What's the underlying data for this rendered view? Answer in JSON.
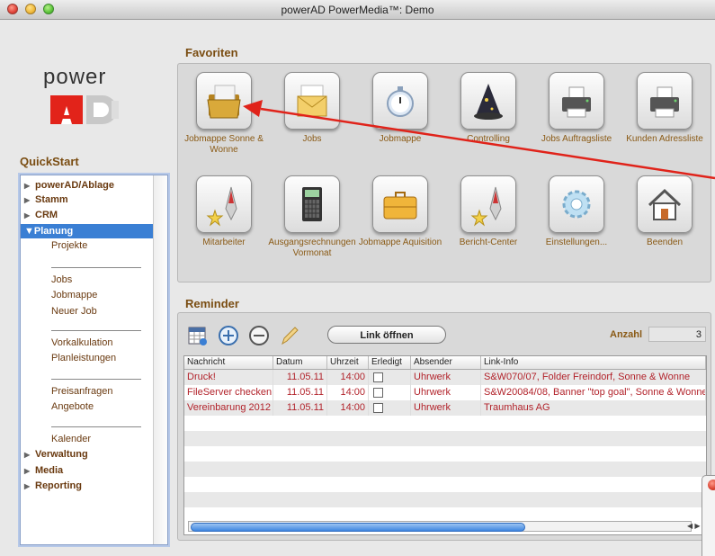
{
  "window": {
    "title": "powerAD PowerMedia™: Demo"
  },
  "logo": {
    "word": "power",
    "letters": "AD"
  },
  "quickstart": {
    "title": "QuickStart",
    "items": [
      {
        "label": "powerAD/Ablage"
      },
      {
        "label": "Stamm"
      },
      {
        "label": "CRM"
      },
      {
        "label": "Planung"
      },
      {
        "label": "Projekte"
      },
      {
        "label": "Jobs"
      },
      {
        "label": "Jobmappe"
      },
      {
        "label": "Neuer Job"
      },
      {
        "label": "Vorkalkulation"
      },
      {
        "label": "Planleistungen"
      },
      {
        "label": "Preisanfragen"
      },
      {
        "label": "Angebote"
      },
      {
        "label": "Kalender"
      },
      {
        "label": "Verwaltung"
      },
      {
        "label": "Media"
      },
      {
        "label": "Reporting"
      }
    ]
  },
  "favorites": {
    "title": "Favoriten",
    "tiles": [
      {
        "label": "Jobmappe Sonne & Wonne",
        "icon": "folder-icon"
      },
      {
        "label": "Jobs",
        "icon": "envelope-icon"
      },
      {
        "label": "Jobmappe",
        "icon": "stopwatch-icon"
      },
      {
        "label": "Controlling",
        "icon": "wizard-hat-icon"
      },
      {
        "label": "Jobs Auftragsliste",
        "icon": "printer-icon"
      },
      {
        "label": "Kunden Adressliste",
        "icon": "printer-icon"
      },
      {
        "label": "Mitarbeiter",
        "icon": "rocket-icon"
      },
      {
        "label": "Ausgangsrechnungen Vormonat",
        "icon": "calculator-icon"
      },
      {
        "label": "Jobmappe Aquisition",
        "icon": "briefcase-icon"
      },
      {
        "label": "Bericht-Center",
        "icon": "rocket-icon"
      },
      {
        "label": "Einstellungen...",
        "icon": "gear-icon"
      },
      {
        "label": "Beenden",
        "icon": "house-icon"
      }
    ]
  },
  "reminder": {
    "title": "Reminder",
    "link_button": "Link öffnen",
    "anzahl_label": "Anzahl",
    "anzahl_value": "3",
    "columns": [
      "Nachricht",
      "Datum",
      "Uhrzeit",
      "Erledigt",
      "Absender",
      "Link-Info"
    ],
    "rows": [
      {
        "nachricht": "Druck!",
        "datum": "11.05.11",
        "uhrzeit": "14:00",
        "erledigt": false,
        "absender": "Uhrwerk",
        "link": "S&W070/07, Folder Freindorf, Sonne & Wonne"
      },
      {
        "nachricht": "FileServer checken",
        "datum": "11.05.11",
        "uhrzeit": "14:00",
        "erledigt": false,
        "absender": "Uhrwerk",
        "link": "S&W20084/08, Banner \"top goal\", Sonne & Wonne"
      },
      {
        "nachricht": "Vereinbarung 2012",
        "datum": "11.05.11",
        "uhrzeit": "14:00",
        "erledigt": false,
        "absender": "Uhrwerk",
        "link": "Traumhaus AG"
      }
    ]
  },
  "colors": {
    "accent_brown": "#7a4d12",
    "selection_blue": "#3a7fd4",
    "row_red": "#b2232b",
    "arrow_red": "#e0231a"
  }
}
